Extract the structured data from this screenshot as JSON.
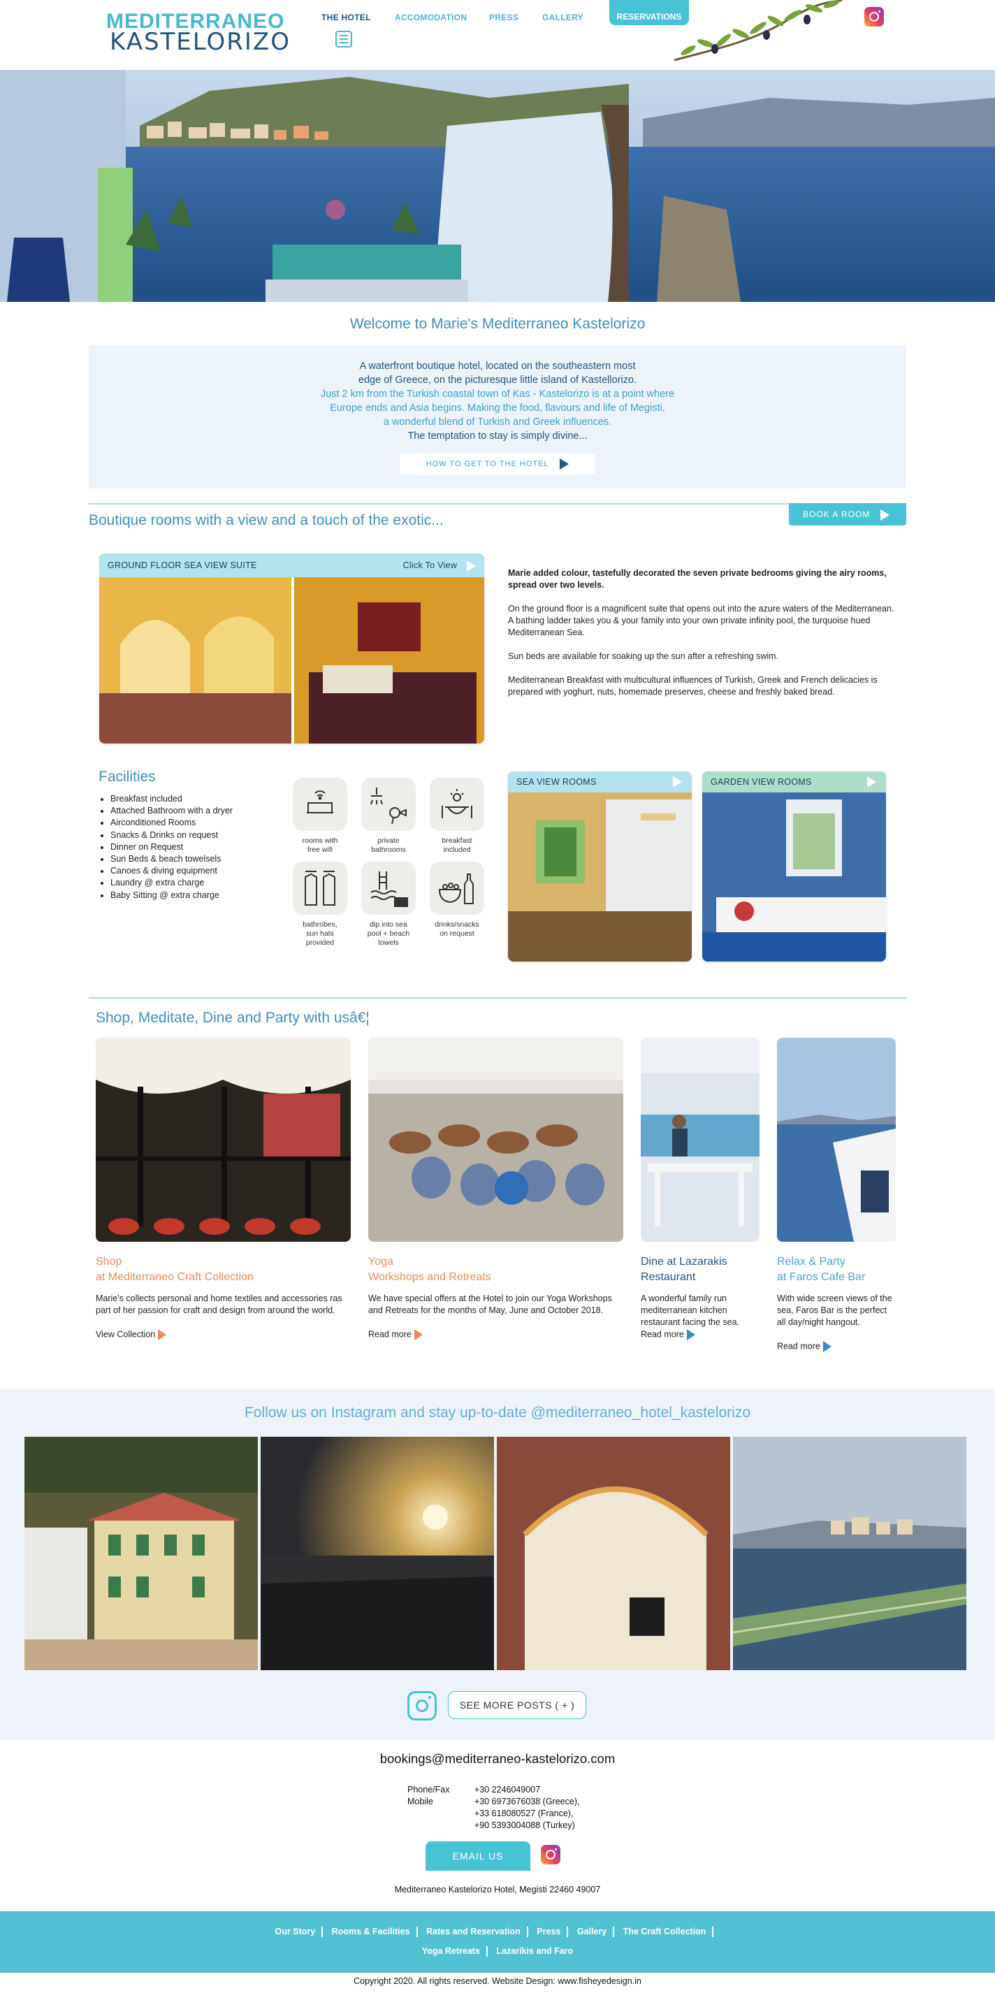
{
  "header": {
    "logo_line1": "MEDITERRANEO",
    "logo_line2": "KASTELORIZO",
    "nav": [
      "THE HOTEL",
      "ACCOMODATION",
      "PRESS",
      "GALLERY"
    ],
    "reservations": "RESERVATIONS"
  },
  "welcome": {
    "title": "Welcome to Marie's Mediterraneo Kastelorizo",
    "line1": "A waterfront boutique hotel, located on the southeastern most",
    "line2": "edge of Greece, on the picturesque little island of Kastellorizo.",
    "line3": "Just 2 km from the Turkish coastal town of Kas - Kastelorizo is at a point where",
    "line4": "Europe ends and Asia begins. Making the food, flavours and life of Megisti,",
    "line5": "a wonderful blend of Turkish and Greek influences.",
    "line6": "The temptation to stay is simply divine...",
    "how_btn": "HOW TO GET TO THE HOTEL"
  },
  "rooms": {
    "title": "Boutique rooms with a view and a touch of the exotic...",
    "book_btn": "BOOK A ROOM",
    "suite_label": "GROUND FLOOR SEA VIEW SUITE",
    "click_view": "Click To View",
    "p1": "Marie added colour, tastefully decorated the seven private bedrooms giving the airy rooms, spread over two levels.",
    "p2": "On the ground floor is a magnificent suite that opens out into the azure waters of the Mediterranean. A bathing ladder takes you & your family into your own private infinity pool, the turquoise hued Mediterranean Sea.",
    "p3": "Sun beds are available for soaking up the sun after a refreshing swim.",
    "p4": "Mediterranean Breakfast with multicultural influences of Turkish, Greek and French delicacies is prepared with yoghurt, nuts, homemade preserves, cheese and freshly baked bread.",
    "sea_view": "SEA VIEW ROOMS",
    "garden_view": "GARDEN VIEW ROOMS"
  },
  "facilities": {
    "title": "Facilities",
    "items": [
      "Breakfast included",
      "Attached Bathroom with a dryer",
      "Airconditioned Rooms",
      "Snacks & Drinks on request",
      "Dinner on Request",
      "Sun Beds & beach towelsels",
      "Canoes & diving equipment",
      "Laundry @ extra charge",
      "Baby Sitting @ extra charge"
    ],
    "icons": [
      {
        "icon": "bed-wifi-icon",
        "caption1": "rooms with",
        "caption2": "free wifi",
        "caption3": ""
      },
      {
        "icon": "shower-dryer-icon",
        "caption1": "private",
        "caption2": "bathrooms",
        "caption3": ""
      },
      {
        "icon": "breakfast-icon",
        "caption1": "breakfast",
        "caption2": "included",
        "caption3": ""
      },
      {
        "icon": "bathrobe-icon",
        "caption1": "bathrobes,",
        "caption2": "sun hats",
        "caption3": "provided"
      },
      {
        "icon": "pool-towel-icon",
        "caption1": "dip into sea",
        "caption2": "pool + beach",
        "caption3": "towels"
      },
      {
        "icon": "drinks-icon",
        "caption1": "drinks/snacks",
        "caption2": "on request",
        "caption3": ""
      }
    ]
  },
  "shop": {
    "title": "Shop, Meditate, Dine and Party with usâ€¦",
    "cards": [
      {
        "h1": "Shop",
        "h2": "at Mediterraneo Craft Collection",
        "p": "Marie's collects personal and home textiles and accessories ras part of her passion for craft and design from around the world.",
        "more": "View Collection"
      },
      {
        "h1": "Yoga",
        "h2": "Workshops and Retreats",
        "p": "We have special offers at the Hotel to join our Yoga Workshops and Retreats for the months of May, June and October 2018.",
        "more": "Read more"
      },
      {
        "h1": "Dine at Lazarakis",
        "h2": "Restaurant",
        "p": "A wonderful family run mediterranean kitchen restaurant facing the sea.",
        "more": "Read more"
      },
      {
        "h1": "Relax & Party",
        "h2": "at Faros Cafe Bar",
        "p": "With wide screen views of the sea, Faros Bar is the perfect all day/night hangout.",
        "more": "Read more"
      }
    ]
  },
  "instagram": {
    "title": "Follow us on Instagram and stay up-to-date @mediterraneo_hotel_kastelorizo",
    "more": "SEE MORE POSTS ( + )"
  },
  "contact": {
    "email": "bookings@mediterraneo-kastelorizo.com",
    "phone_label": "Phone/Fax",
    "mobile_label": "Mobile",
    "phone": "+30 2246049007",
    "m1": "+30 6973676038 (Greece),",
    "m2": "+33 618080527 (France),",
    "m3": "+90 5393004088 (Turkey)",
    "email_btn": "EMAIL US",
    "address": "Mediterraneo Kastelorizo Hotel, Megisti 22460 49007"
  },
  "footer": {
    "row1": [
      "Our Story",
      "Rooms & Facilities",
      "Rates and Reservation",
      "Press",
      "Gallery",
      "The Craft Collection"
    ],
    "row2": [
      "Yoga Retreats",
      "Lazarikis and Faro"
    ],
    "copyright": "Copyright 2020. All rights reserved. Website Design: www.fisheyedesign.in"
  },
  "colors": {
    "accent": "#48c3d6",
    "title_blue": "#3d8fbf",
    "navy": "#22547e",
    "orange": "#ef8a55"
  }
}
